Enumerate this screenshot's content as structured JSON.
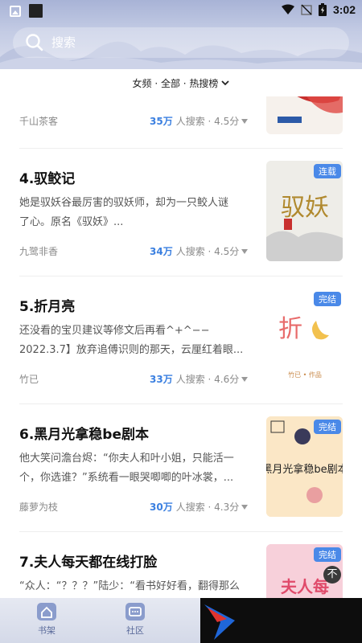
{
  "statusbar": {
    "time": "3:02"
  },
  "search": {
    "placeholder": "搜索"
  },
  "filter": {
    "label": "女频 · 全部 · 热搜榜"
  },
  "items": [
    {
      "title": "",
      "desc": [],
      "author": "千山茶客",
      "searches": "35万",
      "searches_suffix": "人搜索 · 4.5分",
      "badge": "",
      "cover": "cover-1"
    },
    {
      "title": "4.驭鲛记",
      "desc": [
        "她是驭妖谷最厉害的驭妖师，却为一只鲛人谜",
        "了心。原名《驭妖》..."
      ],
      "author": "九鹭非香",
      "searches": "34万",
      "searches_suffix": "人搜索 · 4.5分",
      "badge": "连载",
      "cover": "cover-2"
    },
    {
      "title": "5.折月亮",
      "desc": [
        "还没看的宝贝建议等修文后再看^+^−−",
        "2022.3.7】放弃追傅识则的那天，云厘红着眼..."
      ],
      "author": "竹已",
      "searches": "33万",
      "searches_suffix": "人搜索 · 4.6分",
      "badge": "完结",
      "cover": "cover-3"
    },
    {
      "title": "6.黑月光拿稳be剧本",
      "desc": [
        "他大笑问澹台烬：“你夫人和叶小姐，只能活一",
        "个，你选谁？”系统看一眼哭唧唧的叶冰裳，..."
      ],
      "author": "藤萝为枝",
      "searches": "30万",
      "searches_suffix": "人搜索 · 4.3分",
      "badge": "完结",
      "cover": "cover-4"
    },
    {
      "title": "7.夫人每天都在线打脸",
      "desc": [
        "“众人：“？？？”陆少：“看书好好看，翻得那么"
      ],
      "author": "",
      "searches": "",
      "searches_suffix": "",
      "badge": "完结",
      "cover": "cover-5"
    }
  ],
  "covers": {
    "cover2_text": "驭妖",
    "cover3_text": "折",
    "cover3_sub": "竹已 • 作品",
    "cover4_text": "黑月光拿稳be剧本",
    "cover5_text": "夫人每"
  },
  "bottom_nav": [
    {
      "label": "书架",
      "icon": "house-icon"
    },
    {
      "label": "社区",
      "icon": "chat-icon"
    }
  ],
  "close_button": "不"
}
